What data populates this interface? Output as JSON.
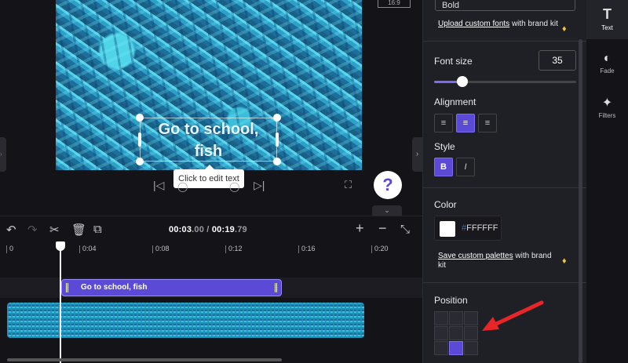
{
  "preview": {
    "overlay_text": "Go to school, fish",
    "tooltip": "Click to edit text",
    "aspect_ratio": "16:9",
    "help_icon": "?"
  },
  "timeline": {
    "current_time": "00:03",
    "current_time_frac": ".00",
    "separator": " / ",
    "total_time": "00:19",
    "total_time_frac": ".79",
    "ticks": [
      "0",
      "0:04",
      "0:08",
      "0:12",
      "0:16",
      "0:20"
    ],
    "text_clip_label": "Go to school, fish"
  },
  "panel": {
    "font_name": "Bold",
    "upload_fonts_link": "Upload custom fonts",
    "upload_fonts_suffix": " with brand kit",
    "font_size_label": "Font size",
    "font_size_value": "35",
    "font_size_slider_fraction": 0.2,
    "alignment_label": "Alignment",
    "style_label": "Style",
    "bold_label": "B",
    "italic_label": "I",
    "color_label": "Color",
    "color_hash": "#",
    "color_value": "FFFFFF",
    "save_palettes_link": "Save custom palettes",
    "save_palettes_suffix": " with brand kit",
    "position_label": "Position",
    "position_selected": "bottom-center"
  },
  "rail": {
    "items": [
      {
        "label": "Text",
        "icon": "T"
      },
      {
        "label": "Fade",
        "icon": "◐"
      },
      {
        "label": "Filters",
        "icon": "✦"
      }
    ]
  },
  "colors": {
    "accent": "#5b4ad6",
    "arrow": "#e8262a"
  }
}
